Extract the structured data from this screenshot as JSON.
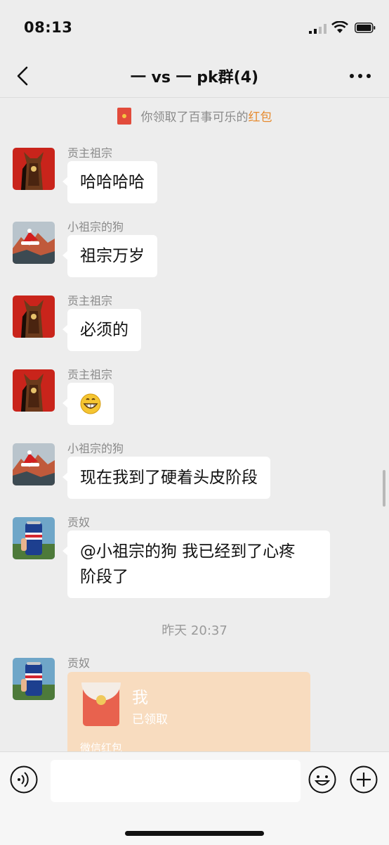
{
  "status_bar": {
    "time": "08:13"
  },
  "nav": {
    "title": "一 vs 一 pk群(4)"
  },
  "system_message": {
    "prefix": "你领取了百事可乐的",
    "link": "红包"
  },
  "messages": [
    {
      "sender": "贡主祖宗",
      "text": "哈哈哈哈",
      "avatar": "horse-avatar"
    },
    {
      "sender": "小祖宗的狗",
      "text": "祖宗万岁",
      "avatar": "mountain-santa-avatar"
    },
    {
      "sender": "贡主祖宗",
      "text": "必须的",
      "avatar": "horse-avatar"
    },
    {
      "sender": "贡主祖宗",
      "text": "",
      "emoji": "grinning-emoji",
      "avatar": "horse-avatar"
    },
    {
      "sender": "小祖宗的狗",
      "text": "现在我到了硬着头皮阶段",
      "avatar": "mountain-santa-avatar"
    },
    {
      "sender": "贡奴",
      "text_line1": "@小祖宗的狗 我已经到了心疼",
      "text_line2": "阶段了",
      "avatar": "pepsi-can-avatar"
    }
  ],
  "timestamp": "昨天 20:37",
  "red_packet": {
    "sender": "贡奴",
    "title": "我",
    "status": "已领取",
    "footer": "微信红包"
  },
  "input_bar": {
    "placeholder": ""
  },
  "colors": {
    "background": "#ededed",
    "bubble": "#ffffff",
    "packet": "#f8dcbf",
    "link": "#e68a2e"
  }
}
